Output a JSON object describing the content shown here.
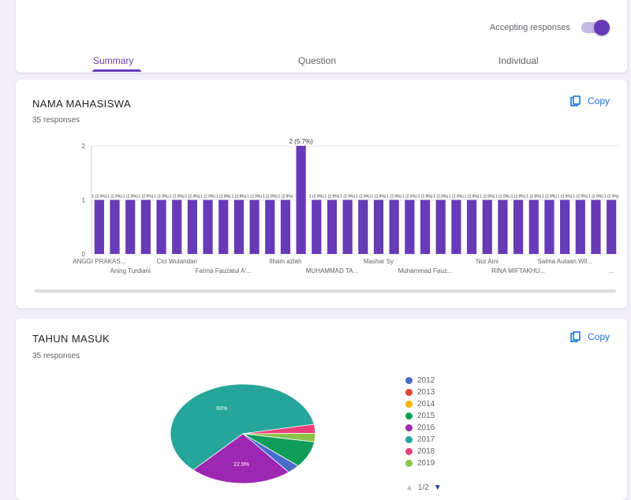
{
  "header": {
    "accepting_label": "Accepting responses",
    "tabs": [
      {
        "label": "Summary",
        "active": true
      },
      {
        "label": "Question",
        "active": false
      },
      {
        "label": "Individual",
        "active": false
      }
    ]
  },
  "colors": {
    "accent": "#673ab7",
    "link": "#1a73e8"
  },
  "questions": [
    {
      "title": "NAMA MAHASISWA",
      "responses": "35 responses",
      "copy_label": "Copy"
    },
    {
      "title": "TAHUN MASUK",
      "responses": "35 responses",
      "copy_label": "Copy"
    }
  ],
  "pager": {
    "prev_icon": "triangle-up-icon",
    "text": "1/2",
    "next_icon": "triangle-down-icon"
  },
  "chart_data": [
    {
      "type": "bar",
      "ylim": [
        0,
        2
      ],
      "yticks": [
        "0",
        "1",
        "2"
      ],
      "bar_count": 34,
      "values": [
        1,
        1,
        1,
        1,
        1,
        1,
        1,
        1,
        1,
        1,
        1,
        1,
        1,
        2,
        1,
        1,
        1,
        1,
        1,
        1,
        1,
        1,
        1,
        1,
        1,
        1,
        1,
        1,
        1,
        1,
        1,
        1,
        1,
        1
      ],
      "data_labels": [
        "1 (2.9%)",
        "1 (2.9%)",
        "1 (2.9%)",
        "1 (2.9%)",
        "1 (2.9%)",
        "1 (2.9%)",
        "1 (2.9%)",
        "1 (2.9%)",
        "1 (2.9%)",
        "1 (2.9%)",
        "1 (2.9%)",
        "1 (2.9%)",
        "1 (2.9%)",
        "2 (5.7%)",
        "1 (2.9%)",
        "1 (2.9%)",
        "1 (2.9%)",
        "1 (2.9%)",
        "1 (2.9%)",
        "1 (2.9%)",
        "1 (2.9%)",
        "1 (2.9%)",
        "1 (2.9%)",
        "1 (2.9%)",
        "1 (2.9%)",
        "1 (2.9%)",
        "1 (2.9%)",
        "1 (2.9%)",
        "1 (2.9%)",
        "1 (2.9%)",
        "1 (2.9%)",
        "1 (2.9%)",
        "1 (2.9%)",
        "1 (2.9%)"
      ],
      "categories_row1": [
        "ANGGI PRAKAS...",
        "Cici Wulandari",
        "Ilham azlah",
        "Mashar Sy",
        "Nur Aini",
        "Salma Aulaan Wil..."
      ],
      "categories_row2": [
        "Aning Turdiani",
        "Fatma Fauzatul A'...",
        "MUHAMMAD TA...",
        "Muhammad Fauz...",
        "RINA MIFTAKHU...",
        "..."
      ],
      "grid": true
    },
    {
      "type": "pie",
      "labels": [
        "2012",
        "2013",
        "2014",
        "2015",
        "2016",
        "2017",
        "2018",
        "2019"
      ],
      "values": [
        2.9,
        0,
        0,
        8.6,
        22.9,
        60,
        2.9,
        2.8
      ],
      "colors": [
        "#4a6cc9",
        "#db4437",
        "#f4b400",
        "#0f9d58",
        "#9c27b0",
        "#26a69a",
        "#ec407a",
        "#8bc34a"
      ],
      "slice_labels": [
        "",
        "",
        "",
        "",
        "22.9%",
        "60%",
        "",
        ""
      ],
      "legend_position": "right"
    }
  ]
}
